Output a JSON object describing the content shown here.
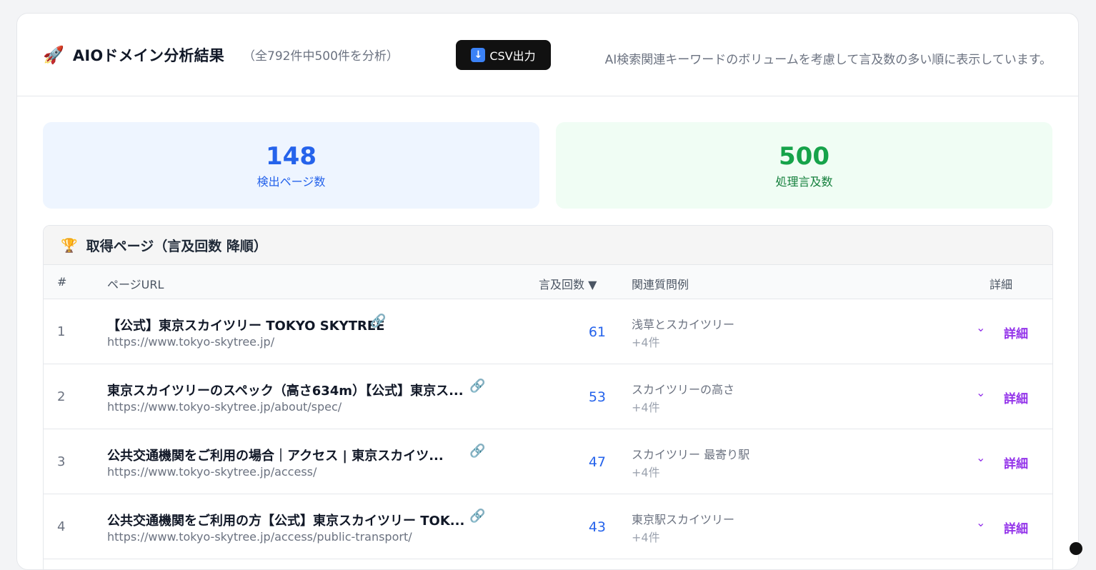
{
  "header": {
    "title": "AIOドメイン分析結果",
    "subtitle": "（全792件中500件を分析）",
    "csv_label": "CSV出力",
    "note": "AI検索関連キーワードのボリュームを考慮して言及数の多い順に表示しています。"
  },
  "stats": {
    "pages": {
      "value": "148",
      "label": "検出ページ数",
      "color": "#2563eb"
    },
    "mentions": {
      "value": "500",
      "label": "処理言及数",
      "color": "#16a34a"
    }
  },
  "table": {
    "title": "取得ページ（言及回数 降順）",
    "columns": {
      "index": "#",
      "url": "ページURL",
      "count": "言及回数 ▼",
      "questions": "関連質問例",
      "detail": "詳細"
    },
    "rows": [
      {
        "index": "1",
        "title": "【公式】東京スカイツリー TOKYO SKYTREE",
        "url": "https://www.tokyo-skytree.jp/",
        "count": "61",
        "question": "浅草とスカイツリー",
        "more": "+4件",
        "detail": "詳細"
      },
      {
        "index": "2",
        "title": "東京スカイツリーのスペック（高さ634m）【公式】東京ス...",
        "url": "https://www.tokyo-skytree.jp/about/spec/",
        "count": "53",
        "question": "スカイツリーの高さ",
        "more": "+4件",
        "detail": "詳細"
      },
      {
        "index": "3",
        "title": "公共交通機関をご利用の場合｜アクセス | 東京スカイツ...",
        "url": "https://www.tokyo-skytree.jp/access/",
        "count": "47",
        "question": "スカイツリー 最寄り駅",
        "more": "+4件",
        "detail": "詳細"
      },
      {
        "index": "4",
        "title": "公共交通機関をご利用の方【公式】東京スカイツリー TOK...",
        "url": "https://www.tokyo-skytree.jp/access/public-transport/",
        "count": "43",
        "question": "東京駅スカイツリー",
        "more": "+4件",
        "detail": "詳細"
      }
    ]
  }
}
